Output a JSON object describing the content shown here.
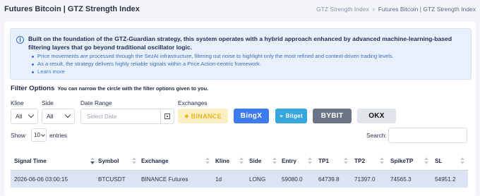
{
  "header": {
    "title": "Futures Bitcoin | GTZ Strength Index",
    "breadcrumb": [
      "GTZ Strength Index",
      "Futures Bitcoin | GTZ Strength Index"
    ],
    "breadcrumb_separator": "›"
  },
  "info": {
    "icon": "info-icon",
    "headline": "Built on the foundation of the GTZ-Guardian strategy, this system operates with a hybrid approach enhanced by advanced machine-learning-based filtering layers that go beyond traditional oscillator logic.",
    "bullets": [
      "Price movements are processed through the SezAI infrastructure, filtering out noise to highlight only the most refined and context-driven trading levels.",
      "As a result, the strategy delivers highly reliable signals within a Price Action-centric framework."
    ],
    "learn_more": "Learn more"
  },
  "filters": {
    "title": "Filter Options",
    "subtitle": "You can narrow the circle with the filter options given to you.",
    "kline_label": "Kline",
    "kline_value": "All",
    "side_label": "Side",
    "side_value": "All",
    "date_label": "Date Range",
    "date_placeholder": "Select Date",
    "exchanges_label": "Exchanges",
    "exchanges": [
      {
        "name": "BINANCE",
        "color": "#e8b521"
      },
      {
        "name": "BingX",
        "color": "#3d7bf0"
      },
      {
        "name": "Bitget",
        "color": "#35a6de"
      },
      {
        "name": "BYBIT",
        "color": "#6b7586"
      },
      {
        "name": "OKX",
        "color": "#111111"
      }
    ]
  },
  "table_controls": {
    "show_label": "Show",
    "page_length": "10",
    "entries_label": "entries",
    "search_label": "Search:"
  },
  "table": {
    "columns": [
      "Signal Time",
      "Symbol",
      "Exchange",
      "Kline",
      "Side",
      "Entry",
      "TP1",
      "TP2",
      "SpikeTP",
      "SL"
    ],
    "rows": [
      [
        "2026-06-06 03:00:15",
        "BTCUSDT",
        "BINANCE Futures",
        "1d",
        "LONG",
        "59080.0",
        "64739.8",
        "71397.0",
        "74565.3",
        "54951.2"
      ]
    ]
  }
}
